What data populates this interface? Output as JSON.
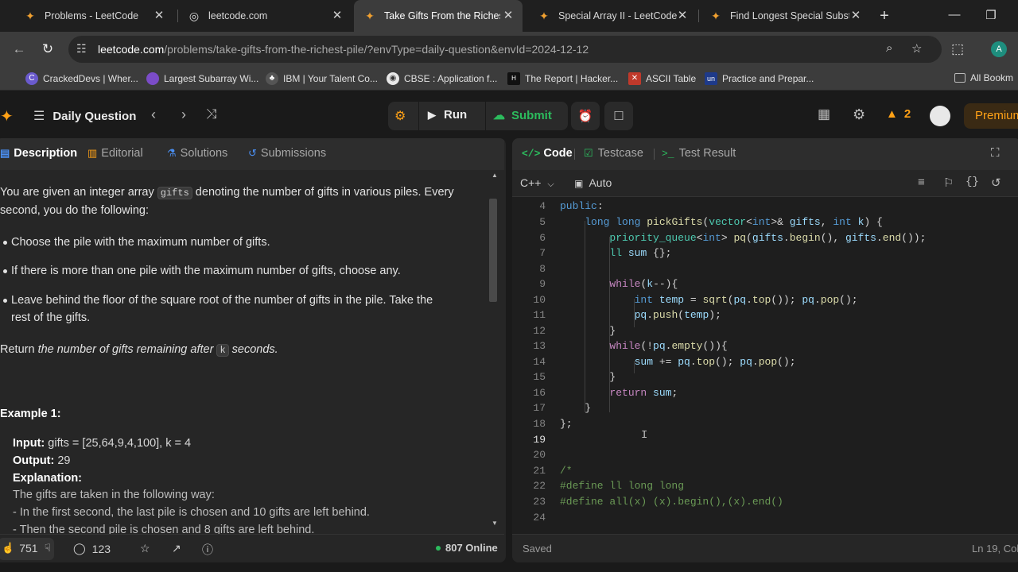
{
  "browser": {
    "tabs": [
      {
        "title": "Problems - LeetCode",
        "icon": "leetcode-icon"
      },
      {
        "title": "leetcode.com",
        "icon": "globe-icon"
      },
      {
        "title": "Take Gifts From the Richest P",
        "icon": "leetcode-icon"
      },
      {
        "title": "Special Array II - LeetCode",
        "icon": "leetcode-icon"
      },
      {
        "title": "Find Longest Special Substri",
        "icon": "leetcode-icon"
      }
    ],
    "url_host": "leetcode.com",
    "url_path": "/problems/take-gifts-from-the-richest-pile/?envType=daily-question&envId=2024-12-12",
    "profile_initial": "A",
    "bookmarks": [
      {
        "label": "CrackedDevs | Wher...",
        "color": "#6a5acd"
      },
      {
        "label": "Largest Subarray Wi...",
        "color": "#7b4cc8"
      },
      {
        "label": "IBM | Your Talent Co...",
        "color": "#555"
      },
      {
        "label": "CBSE : Application f...",
        "color": "#e8e8e8"
      },
      {
        "label": "The Report | Hacker...",
        "color": "#111"
      },
      {
        "label": "ASCII Table",
        "color": "#c0392b"
      },
      {
        "label": "Practice and Prepar...",
        "color": "#1e3a8a"
      },
      {
        "label": "All Bookm",
        "color": "#888"
      }
    ]
  },
  "header": {
    "daily_label": "Daily Question",
    "run_label": "Run",
    "submit_label": "Submit",
    "streak_count": "2",
    "premium_label": "Premium"
  },
  "left": {
    "tabs": [
      "Description",
      "Editorial",
      "Solutions",
      "Submissions"
    ],
    "intro_before": "You are given an integer array ",
    "intro_code": "gifts",
    "intro_after": " denoting the number of gifts in various piles. Every",
    "intro_line2": "second, you do the following:",
    "bullets": [
      "Choose the pile with the maximum number of gifts.",
      "If there is more than one pile with the maximum number of gifts, choose any.",
      "Leave behind the floor of the square root of the number of gifts in the pile. Take the",
      "rest of the gifts."
    ],
    "return_prefix": "Return ",
    "return_italic": "the number of gifts remaining after ",
    "return_code": "k",
    "return_suffix": " seconds.",
    "example_title": "Example 1:",
    "input_label": "Input:",
    "input_value": " gifts = [25,64,9,4,100], k = 4",
    "output_label": "Output:",
    "output_value": " 29",
    "explanation_label": "Explanation:",
    "explanation_lines": [
      "The gifts are taken in the following way:",
      "- In the first second, the last pile is chosen and 10 gifts are left behind.",
      "- Then the second pile is chosen and 8 gifts are left behind."
    ],
    "likes": "751",
    "comments": "123",
    "online": "807 Online"
  },
  "right": {
    "tabs": [
      "Code",
      "Testcase",
      "Test Result"
    ],
    "language": "C++",
    "auto_label": "Auto",
    "line_numbers": [
      "4",
      "5",
      "6",
      "7",
      "8",
      "9",
      "10",
      "11",
      "12",
      "13",
      "14",
      "15",
      "16",
      "17",
      "18",
      "19",
      "20",
      "21",
      "22",
      "23",
      "24"
    ],
    "status_saved": "Saved",
    "cursor_pos": "Ln 19, Col"
  },
  "colors": {
    "accent": "#ffa116",
    "submit": "#2cbb5d"
  }
}
